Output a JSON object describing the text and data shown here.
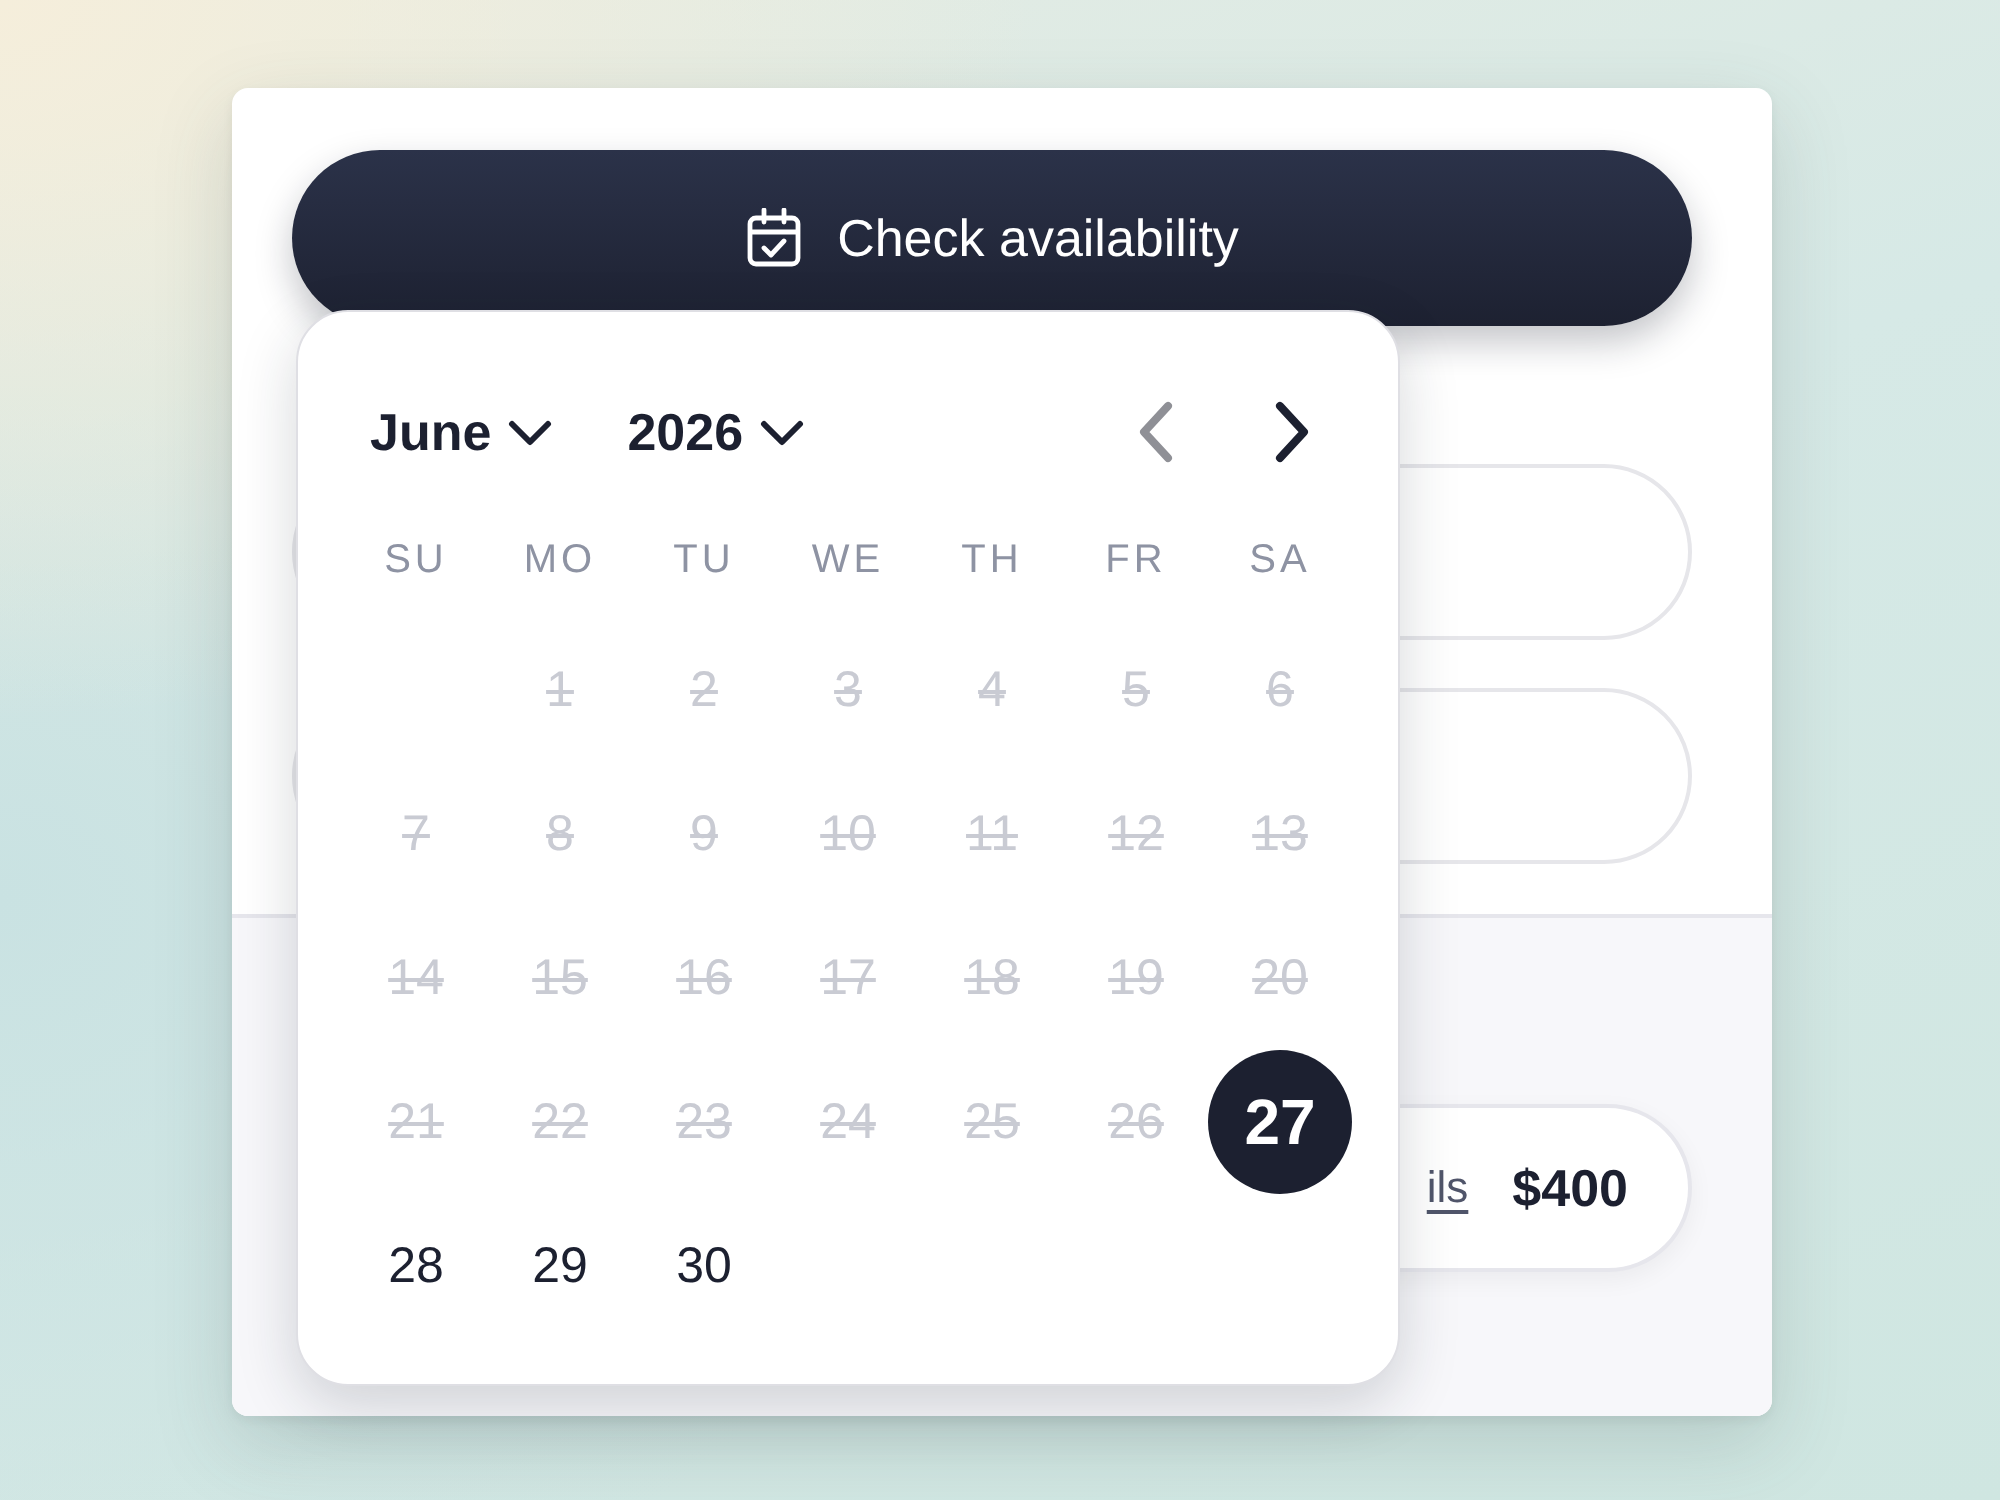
{
  "booking_button": {
    "label": "Check availability"
  },
  "summary": {
    "link": "ils",
    "price": "$400"
  },
  "calendar": {
    "month": "June",
    "year": "2026",
    "nav": [
      {
        "kind": "prev",
        "disabled": true
      },
      {
        "kind": "next",
        "disabled": false
      }
    ],
    "weekdays": [
      "SU",
      "MO",
      "TU",
      "WE",
      "TH",
      "FR",
      "SA"
    ],
    "weeks": [
      [
        {
          "kind": "empty"
        },
        {
          "kind": "day",
          "label": "1",
          "disabled": true,
          "selected": false
        },
        {
          "kind": "day",
          "label": "2",
          "disabled": true,
          "selected": false
        },
        {
          "kind": "day",
          "label": "3",
          "disabled": true,
          "selected": false
        },
        {
          "kind": "day",
          "label": "4",
          "disabled": true,
          "selected": false
        },
        {
          "kind": "day",
          "label": "5",
          "disabled": true,
          "selected": false
        },
        {
          "kind": "day",
          "label": "6",
          "disabled": true,
          "selected": false
        }
      ],
      [
        {
          "kind": "day",
          "label": "7",
          "disabled": true,
          "selected": false
        },
        {
          "kind": "day",
          "label": "8",
          "disabled": true,
          "selected": false
        },
        {
          "kind": "day",
          "label": "9",
          "disabled": true,
          "selected": false
        },
        {
          "kind": "day",
          "label": "10",
          "disabled": true,
          "selected": false
        },
        {
          "kind": "day",
          "label": "11",
          "disabled": true,
          "selected": false
        },
        {
          "kind": "day",
          "label": "12",
          "disabled": true,
          "selected": false
        },
        {
          "kind": "day",
          "label": "13",
          "disabled": true,
          "selected": false
        }
      ],
      [
        {
          "kind": "day",
          "label": "14",
          "disabled": true,
          "selected": false
        },
        {
          "kind": "day",
          "label": "15",
          "disabled": true,
          "selected": false
        },
        {
          "kind": "day",
          "label": "16",
          "disabled": true,
          "selected": false
        },
        {
          "kind": "day",
          "label": "17",
          "disabled": true,
          "selected": false
        },
        {
          "kind": "day",
          "label": "18",
          "disabled": true,
          "selected": false
        },
        {
          "kind": "day",
          "label": "19",
          "disabled": true,
          "selected": false
        },
        {
          "kind": "day",
          "label": "20",
          "disabled": true,
          "selected": false
        }
      ],
      [
        {
          "kind": "day",
          "label": "21",
          "disabled": true,
          "selected": false
        },
        {
          "kind": "day",
          "label": "22",
          "disabled": true,
          "selected": false
        },
        {
          "kind": "day",
          "label": "23",
          "disabled": true,
          "selected": false
        },
        {
          "kind": "day",
          "label": "24",
          "disabled": true,
          "selected": false
        },
        {
          "kind": "day",
          "label": "25",
          "disabled": true,
          "selected": false
        },
        {
          "kind": "day",
          "label": "26",
          "disabled": true,
          "selected": false
        },
        {
          "kind": "day",
          "label": "27",
          "disabled": false,
          "selected": true
        }
      ],
      [
        {
          "kind": "day",
          "label": "28",
          "disabled": false,
          "selected": false
        },
        {
          "kind": "day",
          "label": "29",
          "disabled": false,
          "selected": false
        },
        {
          "kind": "day",
          "label": "30",
          "disabled": false,
          "selected": false
        }
      ]
    ]
  }
}
